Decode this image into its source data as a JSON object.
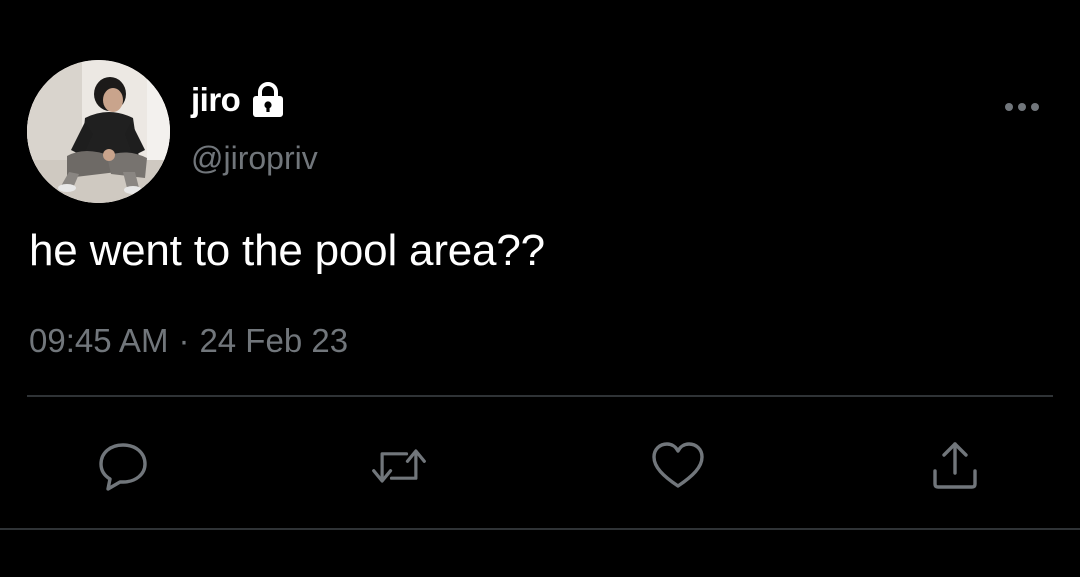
{
  "author": {
    "display_name": "jiro",
    "handle": "@jiropriv",
    "protected_icon": "lock-icon",
    "avatar_icon": "profile-photo"
  },
  "tweet": {
    "text": "he went to the pool area??",
    "time": "09:45 AM",
    "separator": "·",
    "date": "24 Feb 23"
  },
  "actions": {
    "reply_icon": "speech-bubble-icon",
    "retweet_icon": "retweet-arrows-icon",
    "like_icon": "heart-icon",
    "share_icon": "share-upload-icon",
    "more_icon": "ellipsis-icon"
  },
  "colors": {
    "background": "#000000",
    "primary_text": "#ffffff",
    "secondary_text": "#71767b",
    "divider": "#2f3336"
  }
}
